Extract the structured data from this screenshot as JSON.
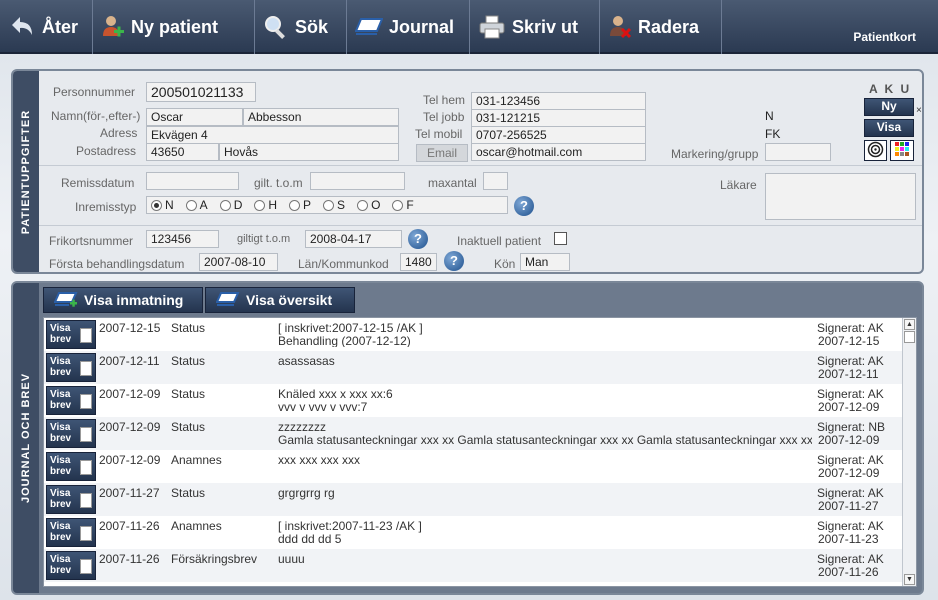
{
  "toolbar": {
    "back": "Åter",
    "new_patient": "Ny patient",
    "search": "Sök",
    "journal": "Journal",
    "print": "Skriv ut",
    "delete": "Radera",
    "title": "Patientkort"
  },
  "patient": {
    "tab": "PATIENTUPPGIFTER",
    "personnummer_label": "Personnummer",
    "personnummer": "200501021133",
    "name_label": "Namn(för-,efter-)",
    "first_name": "Oscar",
    "last_name": "Abbesson",
    "address_label": "Adress",
    "address": "Ekvägen 4",
    "postal_label": "Postadress",
    "postal_code": "43650",
    "city": "Hovås",
    "tel_hem_label": "Tel hem",
    "tel_hem": "031-123456",
    "tel_jobb_label": "Tel jobb",
    "tel_jobb": "031-121215",
    "tel_mobil_label": "Tel mobil",
    "tel_mobil": "0707-256525",
    "email_button": "Email",
    "email": "oscar@hotmail.com",
    "aku_label": "A K U",
    "ny_button": "Ny",
    "visa_button": "Visa",
    "close_x": "×",
    "flag_n": "N",
    "flag_fk": "FK",
    "marking_label": "Markering/grupp",
    "marking": "",
    "remiss_label": "Remissdatum",
    "remiss": "",
    "gilt_label": "gilt. t.o.m",
    "gilt": "",
    "maxantal_label": "maxantal",
    "maxantal": "",
    "inremiss_label": "Inremisstyp",
    "radio_options": [
      "N",
      "A",
      "D",
      "H",
      "P",
      "S",
      "O",
      "F"
    ],
    "radio_selected": "N",
    "lakare_label": "Läkare",
    "lakare": "",
    "frikort_label": "Frikortsnummer",
    "frikort": "123456",
    "giltigt_label": "giltigt t.o.m",
    "giltigt": "2008-04-17",
    "inaktuell_label": "Inaktuell patient",
    "forsta_label": "Första behandlingsdatum",
    "forsta": "2007-08-10",
    "lan_label": "Län/Kommunkod",
    "lan": "1480",
    "kon_label": "Kön",
    "kon": "Man"
  },
  "journal": {
    "tab": "JOURNAL OCH BREV",
    "show_input": "Visa inmatning",
    "show_overview": "Visa översikt",
    "brev_label_1": "Visa",
    "brev_label_2": "brev",
    "rows": [
      {
        "date": "2007-12-15",
        "type": "Status",
        "line1": "   [ inskrivet:2007-12-15 /AK ]",
        "line2": "Behandling (2007-12-12)",
        "signed": "Signerat: AK",
        "sign_date": "2007-12-15"
      },
      {
        "date": "2007-12-11",
        "type": "Status",
        "line1": "asassasas",
        "line2": "",
        "signed": "Signerat: AK",
        "sign_date": "2007-12-11"
      },
      {
        "date": "2007-12-09",
        "type": "Status",
        "line1": "Knäled xxx x xxx xx:6",
        "line2": "vvv v vvv v  vvv:7",
        "signed": "Signerat: AK",
        "sign_date": "2007-12-09"
      },
      {
        "date": "2007-12-09",
        "type": "Status",
        "line1": "zzzzzzzz",
        "line2": "Gamla statusanteckningar xxx xx Gamla statusanteckningar xxx xx Gamla statusanteckningar xxx xx",
        "signed": "Signerat: NB",
        "sign_date": "2007-12-09"
      },
      {
        "date": "2007-12-09",
        "type": "Anamnes",
        "line1": "xxx xxx  xxx xxx",
        "line2": "",
        "signed": "Signerat: AK",
        "sign_date": "2007-12-09"
      },
      {
        "date": "2007-11-27",
        "type": "Status",
        "line1": "grgrgrrg rg",
        "line2": "",
        "signed": "Signerat: AK",
        "sign_date": "2007-11-27"
      },
      {
        "date": "2007-11-26",
        "type": "Anamnes",
        "line1": "   [ inskrivet:2007-11-23 /AK ]",
        "line2": "ddd dd dd    5",
        "signed": "Signerat: AK",
        "sign_date": "2007-11-23"
      },
      {
        "date": "2007-11-26",
        "type": "Försäkringsbrev",
        "line1": "uuuu",
        "line2": "",
        "signed": "Signerat: AK",
        "sign_date": "2007-11-26"
      }
    ]
  }
}
